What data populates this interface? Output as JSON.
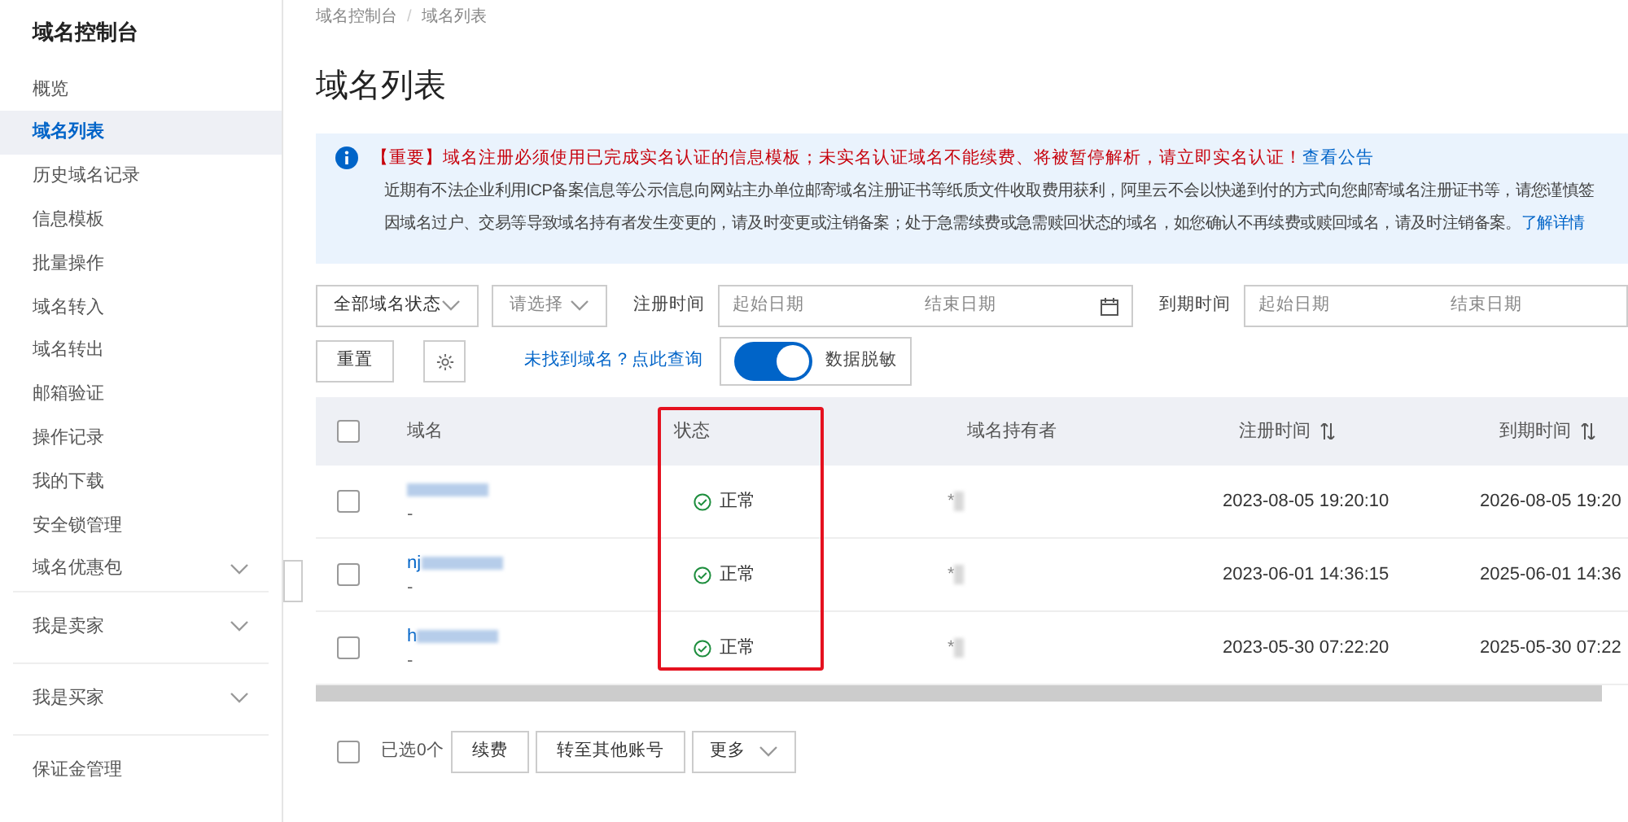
{
  "sidebar": {
    "title": "域名控制台",
    "sections": [
      [
        {
          "label": "概览",
          "selected": false,
          "expandable": false
        },
        {
          "label": "域名列表",
          "selected": true,
          "expandable": false
        },
        {
          "label": "历史域名记录",
          "selected": false,
          "expandable": false
        },
        {
          "label": "信息模板",
          "selected": false,
          "expandable": false
        },
        {
          "label": "批量操作",
          "selected": false,
          "expandable": false
        },
        {
          "label": "域名转入",
          "selected": false,
          "expandable": false
        },
        {
          "label": "域名转出",
          "selected": false,
          "expandable": false
        },
        {
          "label": "邮箱验证",
          "selected": false,
          "expandable": false
        },
        {
          "label": "操作记录",
          "selected": false,
          "expandable": false
        },
        {
          "label": "我的下载",
          "selected": false,
          "expandable": false
        },
        {
          "label": "安全锁管理",
          "selected": false,
          "expandable": false
        },
        {
          "label": "域名优惠包",
          "selected": false,
          "expandable": true
        }
      ],
      [
        {
          "label": "我是卖家",
          "selected": false,
          "expandable": true
        }
      ],
      [
        {
          "label": "我是买家",
          "selected": false,
          "expandable": true
        }
      ],
      [
        {
          "label": "保证金管理",
          "selected": false,
          "expandable": false
        }
      ]
    ]
  },
  "breadcrumb": {
    "items": [
      "域名控制台",
      "域名列表"
    ],
    "separator": "/"
  },
  "page_title": "域名列表",
  "notice": {
    "headline": "【重要】域名注册必须使用已完成实名认证的信息模板；未实名认证域名不能续费、将被暂停解析，请立即实名认证！",
    "headline_link": "查看公告",
    "line_2": "近期有不法企业利用ICP备案信息等公示信息向网站主办单位邮寄域名注册证书等纸质文件收取费用获利，阿里云不会以快递到付的方式向您邮寄域名注册证书等，请您谨慎签",
    "line_3": "因域名过户、交易等导致域名持有者发生变更的，请及时变更或注销备案；处于急需续费或急需赎回状态的域名，如您确认不再续费或赎回域名，请及时注销备案。",
    "line_3_link": "了解详情"
  },
  "filters": {
    "status_select": "全部域名状态",
    "type_select": {
      "placeholder": "请选择"
    },
    "reg_label": "注册时间",
    "reg_start": {
      "placeholder": "起始日期"
    },
    "reg_end": {
      "placeholder": "结束日期"
    },
    "exp_label": "到期时间",
    "exp_start": {
      "placeholder": "起始日期"
    },
    "exp_end": {
      "placeholder": "结束日期"
    },
    "reset": "重置",
    "not_found_link": "未找到域名？点此查询",
    "mask_toggle": {
      "label": "数据脱敏",
      "on": true
    }
  },
  "table": {
    "header_checked": false,
    "columns": [
      "域名",
      "状态",
      "域名持有者",
      "注册时间",
      "到期时间"
    ],
    "rows": [
      {
        "checked": false,
        "domain": "",
        "sub": "-",
        "status": "正常",
        "owner": "*",
        "registered": "2023-08-05 19:20:10",
        "expires": "2026-08-05 19:20"
      },
      {
        "checked": false,
        "domain": "nj",
        "sub": "-",
        "status": "正常",
        "owner": "*",
        "registered": "2023-06-01 14:36:15",
        "expires": "2025-06-01 14:36"
      },
      {
        "checked": false,
        "domain": "h",
        "sub": "-",
        "status": "正常",
        "owner": "*",
        "registered": "2023-05-30 07:22:20",
        "expires": "2025-05-30 07:22"
      }
    ]
  },
  "footer": {
    "select_all_checked": false,
    "selected_count": "已选0个",
    "buttons": [
      "续费",
      "转至其他账号"
    ],
    "more": "更多"
  }
}
